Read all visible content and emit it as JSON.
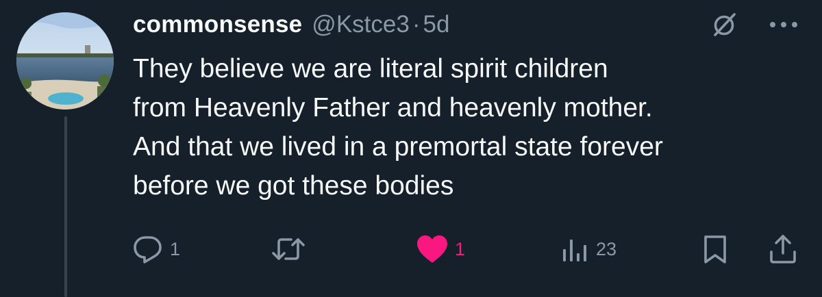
{
  "user": {
    "display_name": "commonsense",
    "handle": "@Kstce3",
    "separator": "·",
    "time": "5d"
  },
  "tweet": {
    "lines": [
      "They believe we are literal spirit children",
      "from Heavenly Father and heavenly mother.",
      "And that we lived in a premortal state forever",
      "before we got these bodies"
    ]
  },
  "actions": {
    "reply_count": "1",
    "like_count": "1",
    "views_count": "23"
  },
  "icons": {
    "grok": "grok-icon",
    "more": "more-icon",
    "reply": "reply-icon",
    "retweet": "retweet-icon",
    "like": "heart-icon",
    "views": "views-icon",
    "bookmark": "bookmark-icon",
    "share": "share-icon"
  },
  "colors": {
    "background": "#15202b",
    "text": "#f7f9f9",
    "secondary": "#8b98a5",
    "like": "#f91880"
  }
}
